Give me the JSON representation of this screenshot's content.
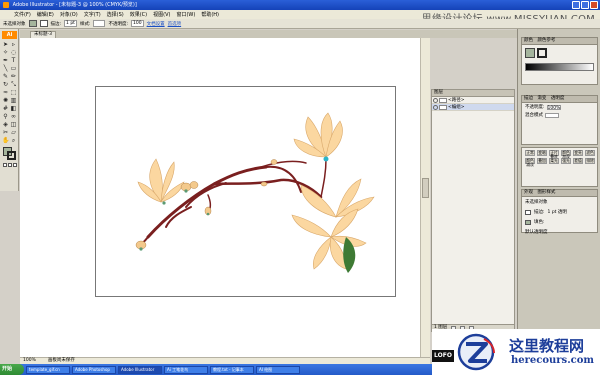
{
  "window": {
    "title": "Adobe Illustrator - [未标题-3 @ 100% (CMYK/预览)]"
  },
  "watermark_top": "思缘设计论坛 www.MISSYUAN.COM",
  "menu": [
    "文件(F)",
    "编辑(E)",
    "对象(O)",
    "文字(T)",
    "选择(S)",
    "效果(C)",
    "视图(V)",
    "窗口(W)",
    "帮助(H)"
  ],
  "controlbar": {
    "object_label": "未选择对象",
    "stroke_label": "描边:",
    "stroke_value": "1 pt",
    "style_label": "样式:",
    "opacity_label": "不透明度:",
    "opacity_value": "100",
    "doc_setup": "文档设置",
    "prefs": "首选项"
  },
  "doc_tab": "未标题-3",
  "toolbox": {
    "badge": "Ai"
  },
  "status": {
    "zoom": "100%",
    "info": "画板尚未保存"
  },
  "layers_panel": {
    "tabs": "图层",
    "rows": [
      {
        "name": "<路径>"
      },
      {
        "name": "<编组>"
      }
    ],
    "footer": "1 图层"
  },
  "right_panels": {
    "color_tabs": [
      "颜色",
      "颜色参考"
    ],
    "transparency_tabs": [
      "描边",
      "渐变",
      "透明度"
    ],
    "opacity_label": "不透明度:",
    "opacity_value": "100%",
    "mode_label": "混合模式",
    "modes": [
      "正常",
      "变暗",
      "正片叠底",
      "颜色加深",
      "变亮",
      "滤色",
      "颜色减淡",
      "叠加",
      "柔光",
      "强光",
      "差值",
      "排除"
    ],
    "appearance_tabs": [
      "外观",
      "图形样式"
    ],
    "appearance_title": "未选择对象",
    "stroke_label": "描边:",
    "stroke_value": "1 pt 透明",
    "fill_label": "填色:",
    "default_opacity": "默认透明度"
  },
  "taskbar": {
    "start": "开始",
    "tasks": [
      "template_gif.cn",
      "Adobe Photoshop",
      "Adobe Illustrator",
      "Ai 工笔花鸟",
      "教程.txt - 记事本",
      "AI 绘图"
    ]
  },
  "watermark": {
    "lofo": "LOFO",
    "title": "这里教程网",
    "url": "herecours.com"
  },
  "colors": {
    "fill": "#a5b59d",
    "branch": "#7a1f1f",
    "petal": "#fbd7a0",
    "accent": "#1d3e9a"
  }
}
